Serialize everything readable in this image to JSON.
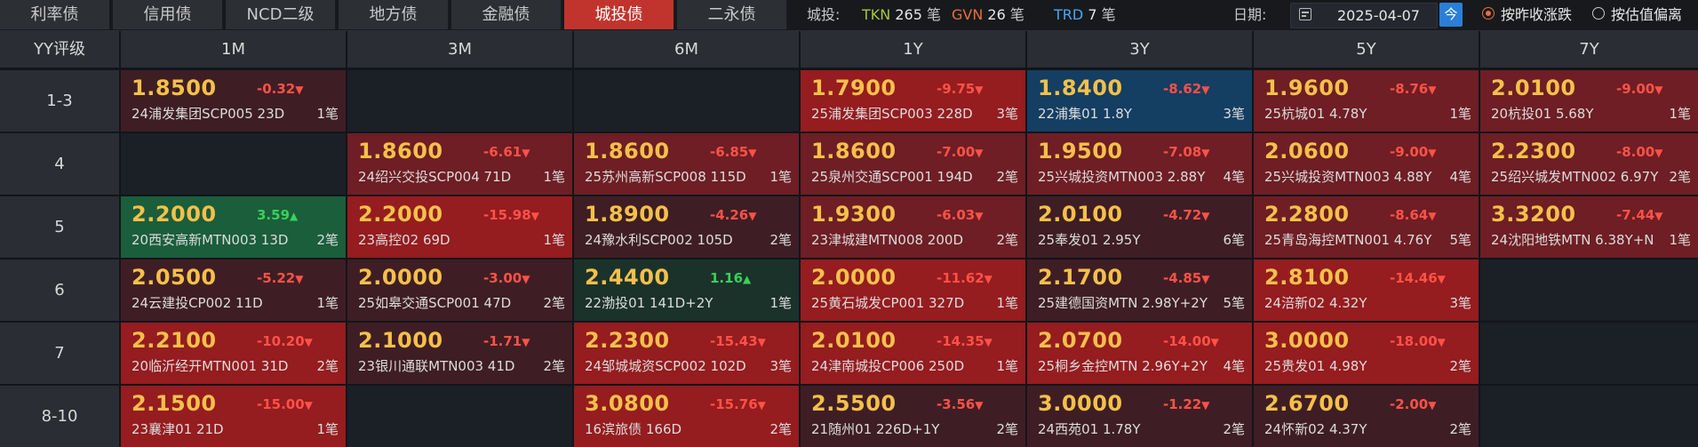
{
  "tabs": [
    {
      "label": "利率债",
      "active": false
    },
    {
      "label": "信用债",
      "active": false
    },
    {
      "label": "NCD二级",
      "active": false
    },
    {
      "label": "地方债",
      "active": false
    },
    {
      "label": "金融债",
      "active": false
    },
    {
      "label": "城投债",
      "active": true
    },
    {
      "label": "二永债",
      "active": false
    }
  ],
  "counts": {
    "label": "城投:",
    "tkn_label": "TKN",
    "tkn_value": "265",
    "tkn_unit": "笔",
    "gvn_label": "GVN",
    "gvn_value": "26",
    "gvn_unit": "笔",
    "trd_label": "TRD",
    "trd_value": "7",
    "trd_unit": "笔"
  },
  "date": {
    "label": "日期:",
    "value": "2025-04-07",
    "today_button": "今"
  },
  "sort_options": [
    {
      "label": "按昨收涨跌",
      "checked": true
    },
    {
      "label": "按估值偏离",
      "checked": false
    }
  ],
  "colors": {
    "red_strong": "#951c1f",
    "red_mid": "#6e1e24",
    "red_light": "#3e1e24",
    "green": "#1a5e3c",
    "green_dark": "#1b322b",
    "blue": "#143e62",
    "empty": "#1b1f26"
  },
  "grid": {
    "corner_label": "YY评级",
    "columns": [
      "1M",
      "3M",
      "6M",
      "1Y",
      "3Y",
      "5Y",
      "7Y"
    ],
    "rows": [
      {
        "label": "1-3",
        "cells": [
          {
            "yield": "1.8500",
            "change": "-0.32",
            "dir": "down",
            "bond": "24浦发集团SCP005 23D",
            "trades": "1笔",
            "color": "red_light"
          },
          null,
          null,
          {
            "yield": "1.7900",
            "change": "-9.75",
            "dir": "down",
            "bond": "25浦发集团SCP003 228D",
            "trades": "3笔",
            "color": "red_strong"
          },
          {
            "yield": "1.8400",
            "change": "-8.62",
            "dir": "down",
            "bond": "22浦集01 1.8Y",
            "trades": "3笔",
            "color": "blue"
          },
          {
            "yield": "1.9600",
            "change": "-8.76",
            "dir": "down",
            "bond": "25杭城01 4.78Y",
            "trades": "1笔",
            "color": "red_mid"
          },
          {
            "yield": "2.0100",
            "change": "-9.00",
            "dir": "down",
            "bond": "20杭投01 5.68Y",
            "trades": "1笔",
            "color": "red_mid"
          }
        ]
      },
      {
        "label": "4",
        "cells": [
          null,
          {
            "yield": "1.8600",
            "change": "-6.61",
            "dir": "down",
            "bond": "24绍兴交投SCP004 71D",
            "trades": "1笔",
            "color": "red_mid"
          },
          {
            "yield": "1.8600",
            "change": "-6.85",
            "dir": "down",
            "bond": "25苏州高新SCP008 115D",
            "trades": "1笔",
            "color": "red_mid"
          },
          {
            "yield": "1.8600",
            "change": "-7.00",
            "dir": "down",
            "bond": "25泉州交通SCP001 194D",
            "trades": "2笔",
            "color": "red_mid"
          },
          {
            "yield": "1.9500",
            "change": "-7.08",
            "dir": "down",
            "bond": "25兴城投资MTN003 2.88Y",
            "trades": "4笔",
            "color": "red_mid"
          },
          {
            "yield": "2.0600",
            "change": "-9.00",
            "dir": "down",
            "bond": "25兴城投资MTN003 4.88Y",
            "trades": "4笔",
            "color": "red_mid"
          },
          {
            "yield": "2.2300",
            "change": "-8.00",
            "dir": "down",
            "bond": "25绍兴城发MTN002 6.97Y",
            "trades": "2笔",
            "color": "red_mid"
          }
        ]
      },
      {
        "label": "5",
        "cells": [
          {
            "yield": "2.2000",
            "change": "3.59",
            "dir": "up",
            "bond": "20西安高新MTN003 13D",
            "trades": "2笔",
            "color": "green"
          },
          {
            "yield": "2.2000",
            "change": "-15.98",
            "dir": "down",
            "bond": "23高控02 69D",
            "trades": "1笔",
            "color": "red_strong"
          },
          {
            "yield": "1.8900",
            "change": "-4.26",
            "dir": "down",
            "bond": "24豫水利SCP002 105D",
            "trades": "2笔",
            "color": "red_light"
          },
          {
            "yield": "1.9300",
            "change": "-6.03",
            "dir": "down",
            "bond": "23津城建MTN008 200D",
            "trades": "2笔",
            "color": "red_mid"
          },
          {
            "yield": "2.0100",
            "change": "-4.72",
            "dir": "down",
            "bond": "25奉发01 2.95Y",
            "trades": "6笔",
            "color": "red_light"
          },
          {
            "yield": "2.2800",
            "change": "-8.64",
            "dir": "down",
            "bond": "25青岛海控MTN001 4.76Y",
            "trades": "5笔",
            "color": "red_mid"
          },
          {
            "yield": "3.3200",
            "change": "-7.44",
            "dir": "down",
            "bond": "24沈阳地铁MTN 6.38Y+N",
            "trades": "1笔",
            "color": "red_mid"
          }
        ]
      },
      {
        "label": "6",
        "cells": [
          {
            "yield": "2.0500",
            "change": "-5.22",
            "dir": "down",
            "bond": "24云建投CP002 11D",
            "trades": "1笔",
            "color": "red_light"
          },
          {
            "yield": "2.0000",
            "change": "-3.00",
            "dir": "down",
            "bond": "25如皋交通SCP001 47D",
            "trades": "2笔",
            "color": "red_light"
          },
          {
            "yield": "2.4400",
            "change": "1.16",
            "dir": "up",
            "bond": "22渤投01 141D+2Y",
            "trades": "1笔",
            "color": "green_dark"
          },
          {
            "yield": "2.0000",
            "change": "-11.62",
            "dir": "down",
            "bond": "25黄石城发CP001 327D",
            "trades": "1笔",
            "color": "red_strong"
          },
          {
            "yield": "2.1700",
            "change": "-4.85",
            "dir": "down",
            "bond": "25建德国资MTN 2.98Y+2Y",
            "trades": "5笔",
            "color": "red_light"
          },
          {
            "yield": "2.8100",
            "change": "-14.46",
            "dir": "down",
            "bond": "24涪新02 4.32Y",
            "trades": "3笔",
            "color": "red_strong"
          },
          null
        ]
      },
      {
        "label": "7",
        "cells": [
          {
            "yield": "2.2100",
            "change": "-10.20",
            "dir": "down",
            "bond": "20临沂经开MTN001 31D",
            "trades": "2笔",
            "color": "red_strong"
          },
          {
            "yield": "2.1000",
            "change": "-1.71",
            "dir": "down",
            "bond": "23银川通联MTN003 41D",
            "trades": "2笔",
            "color": "red_light"
          },
          {
            "yield": "2.2300",
            "change": "-15.43",
            "dir": "down",
            "bond": "24邹城城资SCP002 102D",
            "trades": "3笔",
            "color": "red_strong"
          },
          {
            "yield": "2.0100",
            "change": "-14.35",
            "dir": "down",
            "bond": "24津南城投CP006 250D",
            "trades": "1笔",
            "color": "red_strong"
          },
          {
            "yield": "2.0700",
            "change": "-14.00",
            "dir": "down",
            "bond": "25桐乡金控MTN 2.96Y+2Y",
            "trades": "4笔",
            "color": "red_strong"
          },
          {
            "yield": "3.0000",
            "change": "-18.00",
            "dir": "down",
            "bond": "25贵发01 4.98Y",
            "trades": "2笔",
            "color": "red_strong"
          },
          null
        ]
      },
      {
        "label": "8-10",
        "cells": [
          {
            "yield": "2.1500",
            "change": "-15.00",
            "dir": "down",
            "bond": "23襄津01 21D",
            "trades": "1笔",
            "color": "red_strong"
          },
          null,
          {
            "yield": "3.0800",
            "change": "-15.76",
            "dir": "down",
            "bond": "16滨旅债 166D",
            "trades": "2笔",
            "color": "red_strong"
          },
          {
            "yield": "2.5500",
            "change": "-3.56",
            "dir": "down",
            "bond": "21随州01 226D+1Y",
            "trades": "2笔",
            "color": "red_light"
          },
          {
            "yield": "3.0000",
            "change": "-1.22",
            "dir": "down",
            "bond": "24西苑01 1.78Y",
            "trades": "2笔",
            "color": "red_light"
          },
          {
            "yield": "2.6700",
            "change": "-2.00",
            "dir": "down",
            "bond": "24怀新02 4.37Y",
            "trades": "2笔",
            "color": "red_light"
          },
          null
        ]
      }
    ]
  }
}
